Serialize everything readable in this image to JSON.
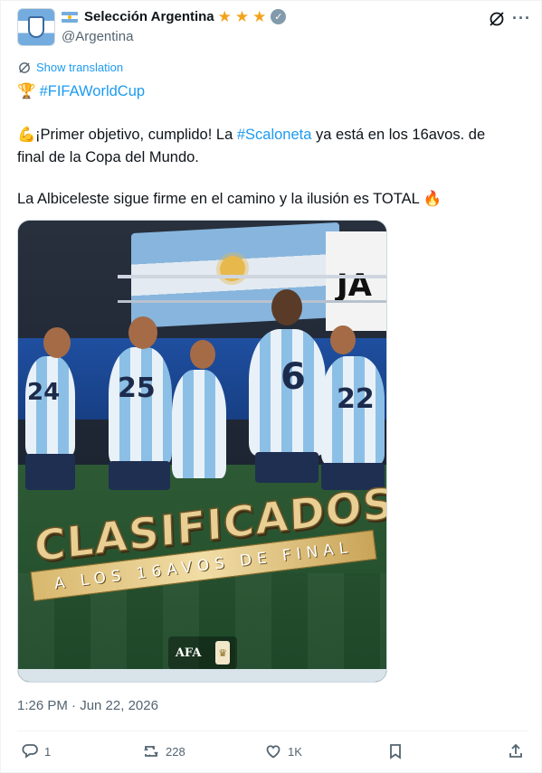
{
  "author": {
    "display_name": "Selección Argentina",
    "handle": "@Argentina",
    "stars": [
      "★",
      "★",
      "★"
    ],
    "verified_mark": "✓"
  },
  "header_icons": {
    "grok": "grok-icon",
    "more": "···"
  },
  "translate": {
    "label": "Show translation"
  },
  "tweet": {
    "hashtag_emoji": "🏆",
    "hashtag_line": "#FIFAWorldCup",
    "p1_emoji": "💪",
    "p1_part1": "¡Primer objetivo, cumplido! La ",
    "p1_hashtag": "#Scaloneta",
    "p1_part2": " ya está en los 16avos. de",
    "p1_line2": "final de la Copa del Mundo.",
    "p2_text": "La Albiceleste sigue firme en el camino y la ilusión es TOTAL ",
    "p2_emoji": "🔥"
  },
  "media": {
    "title": "CLASIFICADOS",
    "subtitle": "A LOS 16AVOS DE FINAL",
    "banner_text": "JA",
    "logo_text": "AFA",
    "player_numbers": [
      "24",
      "25",
      "6",
      "22"
    ]
  },
  "timestamp": "1:26 PM · Jun 22, 2026",
  "actions": {
    "reply_count": "1",
    "retweet_count": "228",
    "like_count": "1K"
  },
  "colors": {
    "link": "#1d9bf0",
    "muted": "#536471",
    "star": "#f4a21b"
  }
}
